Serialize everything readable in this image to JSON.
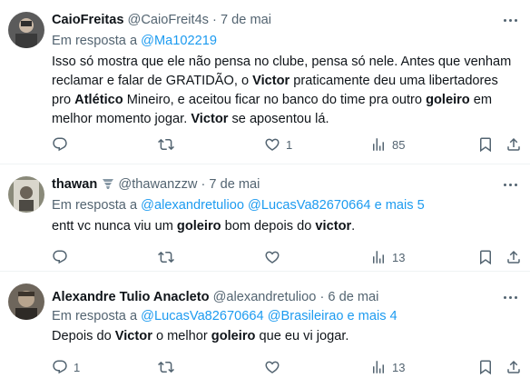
{
  "tweets": [
    {
      "name": "CaioFreitas",
      "handle": "@CaioFreit4s",
      "separator": "·",
      "date": "7 de mai",
      "reply_prefix": "Em resposta a",
      "mentions": [
        "@Ma102219"
      ],
      "body": [
        {
          "t": "Isso só mostra que ele não pensa no clube, pensa só nele. Antes que venham reclamar e falar de GRATIDÃO, o ",
          "b": false
        },
        {
          "t": "Victor",
          "b": true
        },
        {
          "t": " praticamente deu uma libertadores pro ",
          "b": false
        },
        {
          "t": "Atlético",
          "b": true
        },
        {
          "t": " Mineiro, e aceitou ficar no banco do time pra outro ",
          "b": false
        },
        {
          "t": "goleiro",
          "b": true
        },
        {
          "t": " em melhor momento jogar. ",
          "b": false
        },
        {
          "t": "Victor",
          "b": true
        },
        {
          "t": " se aposentou lá.",
          "b": false
        }
      ],
      "replies": "",
      "retweets": "",
      "likes": "1",
      "views": "85"
    },
    {
      "name": "thawan",
      "handle": "@thawanzzw",
      "separator": "·",
      "date": "7 de mai",
      "reply_prefix": "Em resposta a",
      "mentions": [
        "@alexandretulioo",
        "@LucasVa82670664",
        "e mais 5"
      ],
      "body": [
        {
          "t": "entt vc nunca viu um ",
          "b": false
        },
        {
          "t": "goleiro",
          "b": true
        },
        {
          "t": " bom depois do ",
          "b": false
        },
        {
          "t": "victor",
          "b": true
        },
        {
          "t": ".",
          "b": false
        }
      ],
      "replies": "",
      "retweets": "",
      "likes": "",
      "views": "13"
    },
    {
      "name": "Alexandre Tulio Anacleto",
      "handle": "@alexandretulioo",
      "separator": "·",
      "date": "6 de mai",
      "reply_prefix": "Em resposta a",
      "mentions": [
        "@LucasVa82670664",
        "@Brasileirao",
        "e mais 4"
      ],
      "body": [
        {
          "t": "Depois do ",
          "b": false
        },
        {
          "t": "Victor",
          "b": true
        },
        {
          "t": " o melhor ",
          "b": false
        },
        {
          "t": "goleiro",
          "b": true
        },
        {
          "t": " que eu vi jogar.",
          "b": false
        }
      ],
      "replies": "1",
      "retweets": "",
      "likes": "",
      "views": "13"
    }
  ],
  "icons": [
    "reply-icon",
    "retweet-icon",
    "like-icon",
    "views-icon",
    "bookmark-icon",
    "share-icon",
    "more-icon"
  ],
  "colors": {
    "text": "#0f1419",
    "secondary": "#536471",
    "link": "#1d9bf0",
    "divider": "#eff3f4"
  }
}
